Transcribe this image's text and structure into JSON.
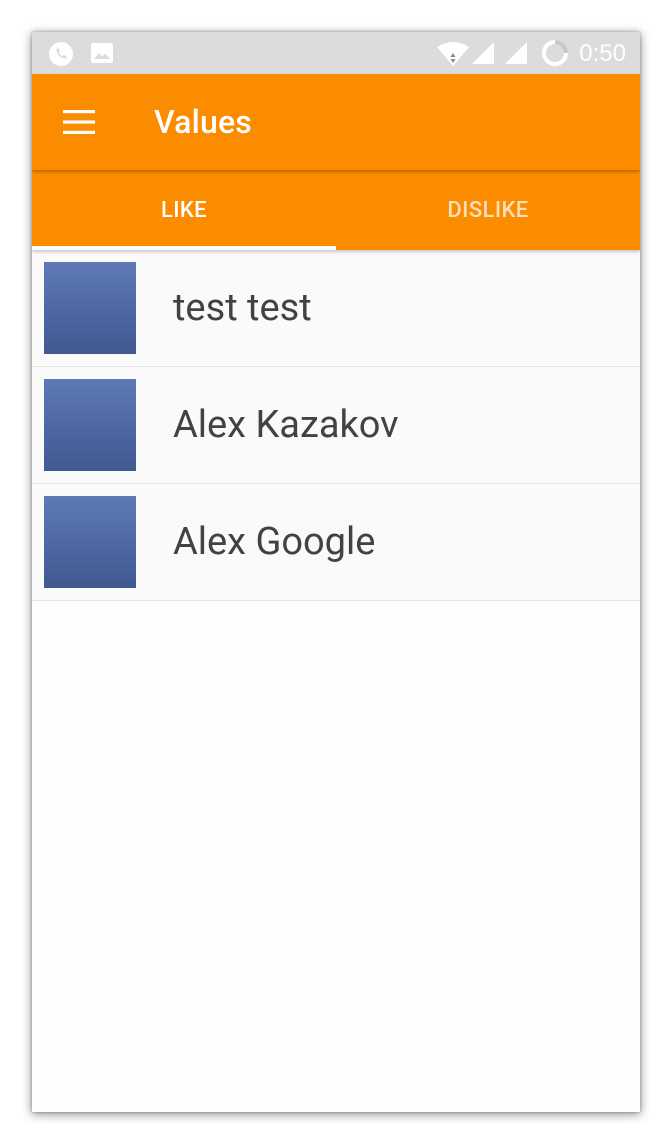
{
  "status_bar": {
    "time": "0:50",
    "icons_left": [
      "phone-icon",
      "image-icon"
    ],
    "icons_right": [
      "wifi-icon",
      "signal-icon",
      "signal-icon",
      "battery-charging-icon"
    ]
  },
  "app_bar": {
    "title": "Values",
    "menu_icon": "hamburger-menu-icon",
    "background": "#fb8c00"
  },
  "tabs": [
    {
      "label": "LIKE",
      "selected": true
    },
    {
      "label": "DISLIKE",
      "selected": false
    }
  ],
  "list": {
    "items": [
      {
        "name": "test test",
        "avatar": "facebook-avatar"
      },
      {
        "name": "Alex Kazakov",
        "avatar": "facebook-avatar"
      },
      {
        "name": "Alex Google",
        "avatar": "facebook-avatar"
      }
    ]
  },
  "colors": {
    "accent": "#fb8c00",
    "avatar": "#4d67a3",
    "status_bar": "#dcdcdc"
  }
}
